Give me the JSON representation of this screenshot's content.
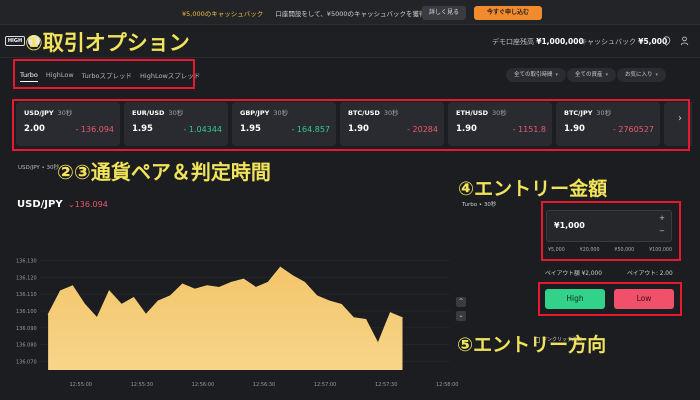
{
  "promo": {
    "text_pre": "¥5,000のキャッシュバック",
    "text_main": "口座開設をして、¥5000のキャッシュバックを獲得しよう!",
    "detail_button": "詳しく見る",
    "apply_button": "今すぐ申し込む"
  },
  "topbar": {
    "demo_label": "デモ口座残高",
    "demo_value": "¥1,000,000",
    "cashback_label": "キャッシュバック",
    "cashback_value": "¥5,000"
  },
  "option_tabs": [
    "Turbo",
    "HighLow",
    "Turboスプレッド",
    "HighLowスプレッド"
  ],
  "filters": {
    "all_periods": "全ての取引時間",
    "all_assets": "全ての資産",
    "favorites": "お気に入り"
  },
  "pairs": [
    {
      "name": "USD/JPY",
      "time": "30秒",
      "payout": "2.00",
      "change": "- 136.094",
      "dir": "neg"
    },
    {
      "name": "EUR/USD",
      "time": "30秒",
      "payout": "1.95",
      "change": "- 1.04344",
      "dir": "pos"
    },
    {
      "name": "GBP/JPY",
      "time": "30秒",
      "payout": "1.95",
      "change": "- 164.857",
      "dir": "pos"
    },
    {
      "name": "BTC/USD",
      "time": "30秒",
      "payout": "1.90",
      "change": "- 20284",
      "dir": "neg"
    },
    {
      "name": "ETH/USD",
      "time": "30秒",
      "payout": "1.90",
      "change": "- 1151.8",
      "dir": "neg"
    },
    {
      "name": "BTC/JPY",
      "time": "30秒",
      "payout": "1.90",
      "change": "- 2760527",
      "dir": "neg"
    }
  ],
  "subtab": "USD/JPY • 30秒",
  "chart_header": {
    "pair": "USD/JPY",
    "change": "136.094"
  },
  "panel": {
    "product": "Turbo • 30秒",
    "amount": "¥1,000",
    "quick_amounts": [
      "¥5,000",
      "¥20,000",
      "¥50,000",
      "¥100,000"
    ],
    "payout_amount": "ペイアウト額 ¥2,000",
    "payout_rate": "ペイアウト: 2.00",
    "high_label": "High",
    "low_label": "Low",
    "one_click": "ワンクリック注文"
  },
  "annotations": {
    "a1": "①取引オプション",
    "a2": "②③通貨ペア＆判定時間",
    "a4": "④エントリー金額",
    "a5": "⑤エントリー方向"
  },
  "chart_data": {
    "type": "area",
    "title": "",
    "xlabel": "",
    "ylabel": "",
    "x_ticks": [
      "12:55:00",
      "12:55:30",
      "12:56:00",
      "12:56:30",
      "12:57:00",
      "12:57:30",
      "12:58:00"
    ],
    "y_ticks": [
      136.07,
      136.08,
      136.09,
      136.1,
      136.11,
      136.12,
      136.13
    ],
    "ylim": [
      136.065,
      136.135
    ],
    "x": [
      "12:54:44",
      "12:54:50",
      "12:54:56",
      "12:55:02",
      "12:55:08",
      "12:55:14",
      "12:55:20",
      "12:55:26",
      "12:55:32",
      "12:55:38",
      "12:55:44",
      "12:55:50",
      "12:55:56",
      "12:56:02",
      "12:56:08",
      "12:56:14",
      "12:56:20",
      "12:56:26",
      "12:56:32",
      "12:56:38",
      "12:56:44",
      "12:56:50",
      "12:56:56",
      "12:57:02",
      "12:57:08",
      "12:57:14",
      "12:57:20",
      "12:57:26",
      "12:57:32",
      "12:57:38"
    ],
    "values": [
      136.098,
      136.112,
      136.115,
      136.104,
      136.096,
      136.112,
      136.104,
      136.108,
      136.098,
      136.106,
      136.109,
      136.116,
      136.113,
      136.115,
      136.114,
      136.117,
      136.119,
      136.114,
      136.117,
      136.126,
      136.121,
      136.117,
      136.109,
      136.106,
      136.104,
      136.096,
      136.095,
      136.081,
      136.099,
      136.096
    ],
    "grid": true,
    "colors": {
      "fill_top": "#f3c56a",
      "fill_bottom": "#f7d58a"
    }
  }
}
